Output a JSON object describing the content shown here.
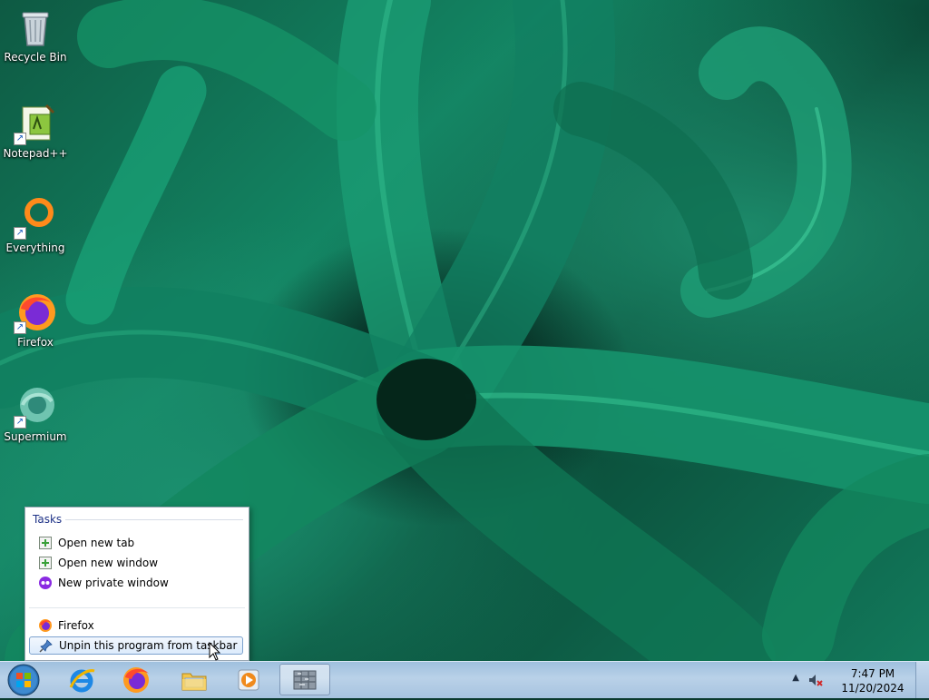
{
  "desktop": {
    "icons": [
      {
        "label": "Recycle Bin",
        "icon": "recycle-bin-icon"
      },
      {
        "label": "Notepad++",
        "icon": "notepad-plus-plus-icon"
      },
      {
        "label": "Everything",
        "icon": "everything-search-icon"
      },
      {
        "label": "Firefox",
        "icon": "firefox-icon"
      },
      {
        "label": "Supermium",
        "icon": "supermium-icon"
      }
    ]
  },
  "jumplist": {
    "header": "Tasks",
    "tasks": [
      {
        "label": "Open new tab",
        "icon": "new-tab-icon"
      },
      {
        "label": "Open new window",
        "icon": "new-window-icon"
      },
      {
        "label": "New private window",
        "icon": "private-window-icon"
      }
    ],
    "app_label": "Firefox",
    "unpin_label": "Unpin this program from taskbar"
  },
  "taskbar": {
    "pinned": [
      {
        "name": "Internet Explorer",
        "icon": "internet-explorer-icon"
      },
      {
        "name": "Firefox",
        "icon": "firefox-icon"
      },
      {
        "name": "Windows Explorer",
        "icon": "folder-icon"
      },
      {
        "name": "Windows Media Player",
        "icon": "media-player-icon"
      },
      {
        "name": "Application",
        "icon": "app-window-icon"
      }
    ],
    "clock_time": "7:47 PM",
    "clock_date": "11/20/2024"
  },
  "colors": {
    "jumplist_header": "#1e3287",
    "hover_border": "#7da2ce",
    "taskbar": "#b9d1e8"
  }
}
